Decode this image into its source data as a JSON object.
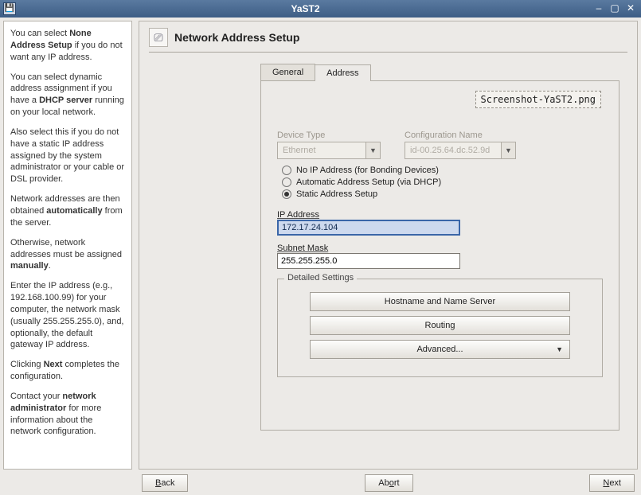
{
  "window": {
    "title": "YaST2",
    "app_icon": "💾"
  },
  "help": {
    "p1a": "You can select ",
    "p1b": "None Address Setup",
    "p1c": " if you do not want any IP address.",
    "p2a": "You can select dynamic address assignment if you have a ",
    "p2b": "DHCP server",
    "p2c": " running on your local network.",
    "p3": "Also select this if you do not have a static IP address assigned by the system administrator or your cable or DSL provider.",
    "p4a": "Network addresses are then obtained ",
    "p4b": "automatically",
    "p4c": " from the server.",
    "p5a": "Otherwise, network addresses must be assigned ",
    "p5b": "manually",
    "p5c": ".",
    "p6": "Enter the IP address (e.g., 192.168.100.99) for your computer, the network mask (usually 255.255.255.0), and, optionally, the default gateway IP address.",
    "p7a": "Clicking ",
    "p7b": "Next",
    "p7c": " completes the configuration.",
    "p8a": "Contact your ",
    "p8b": "network administrator",
    "p8c": " for more information about the network configuration."
  },
  "main": {
    "title": "Network Address Setup",
    "icon_glyph": "⎚",
    "tabs": {
      "general": "General",
      "address": "Address"
    },
    "filehint": "Screenshot-YaST2.png",
    "device_type_label": "Device Type",
    "device_type_value": "Ethernet",
    "config_name_label": "Configuration Name",
    "config_name_value": "id-00.25.64.dc.52.9d",
    "radios": {
      "none": "No IP Address (for Bonding Devices)",
      "dhcp": "Automatic Address Setup (via DHCP)",
      "static": "Static Address Setup"
    },
    "ip_label": "IP Address",
    "ip_value": "172.17.24.104",
    "mask_label": "Subnet Mask",
    "mask_value": "255.255.255.0",
    "detailed_legend": "Detailed Settings",
    "btn_hostname": "Hostname and Name Server",
    "btn_routing": "Routing",
    "btn_advanced": "Advanced..."
  },
  "footer": {
    "back": "Back",
    "abort": "Abort",
    "next": "Next"
  }
}
